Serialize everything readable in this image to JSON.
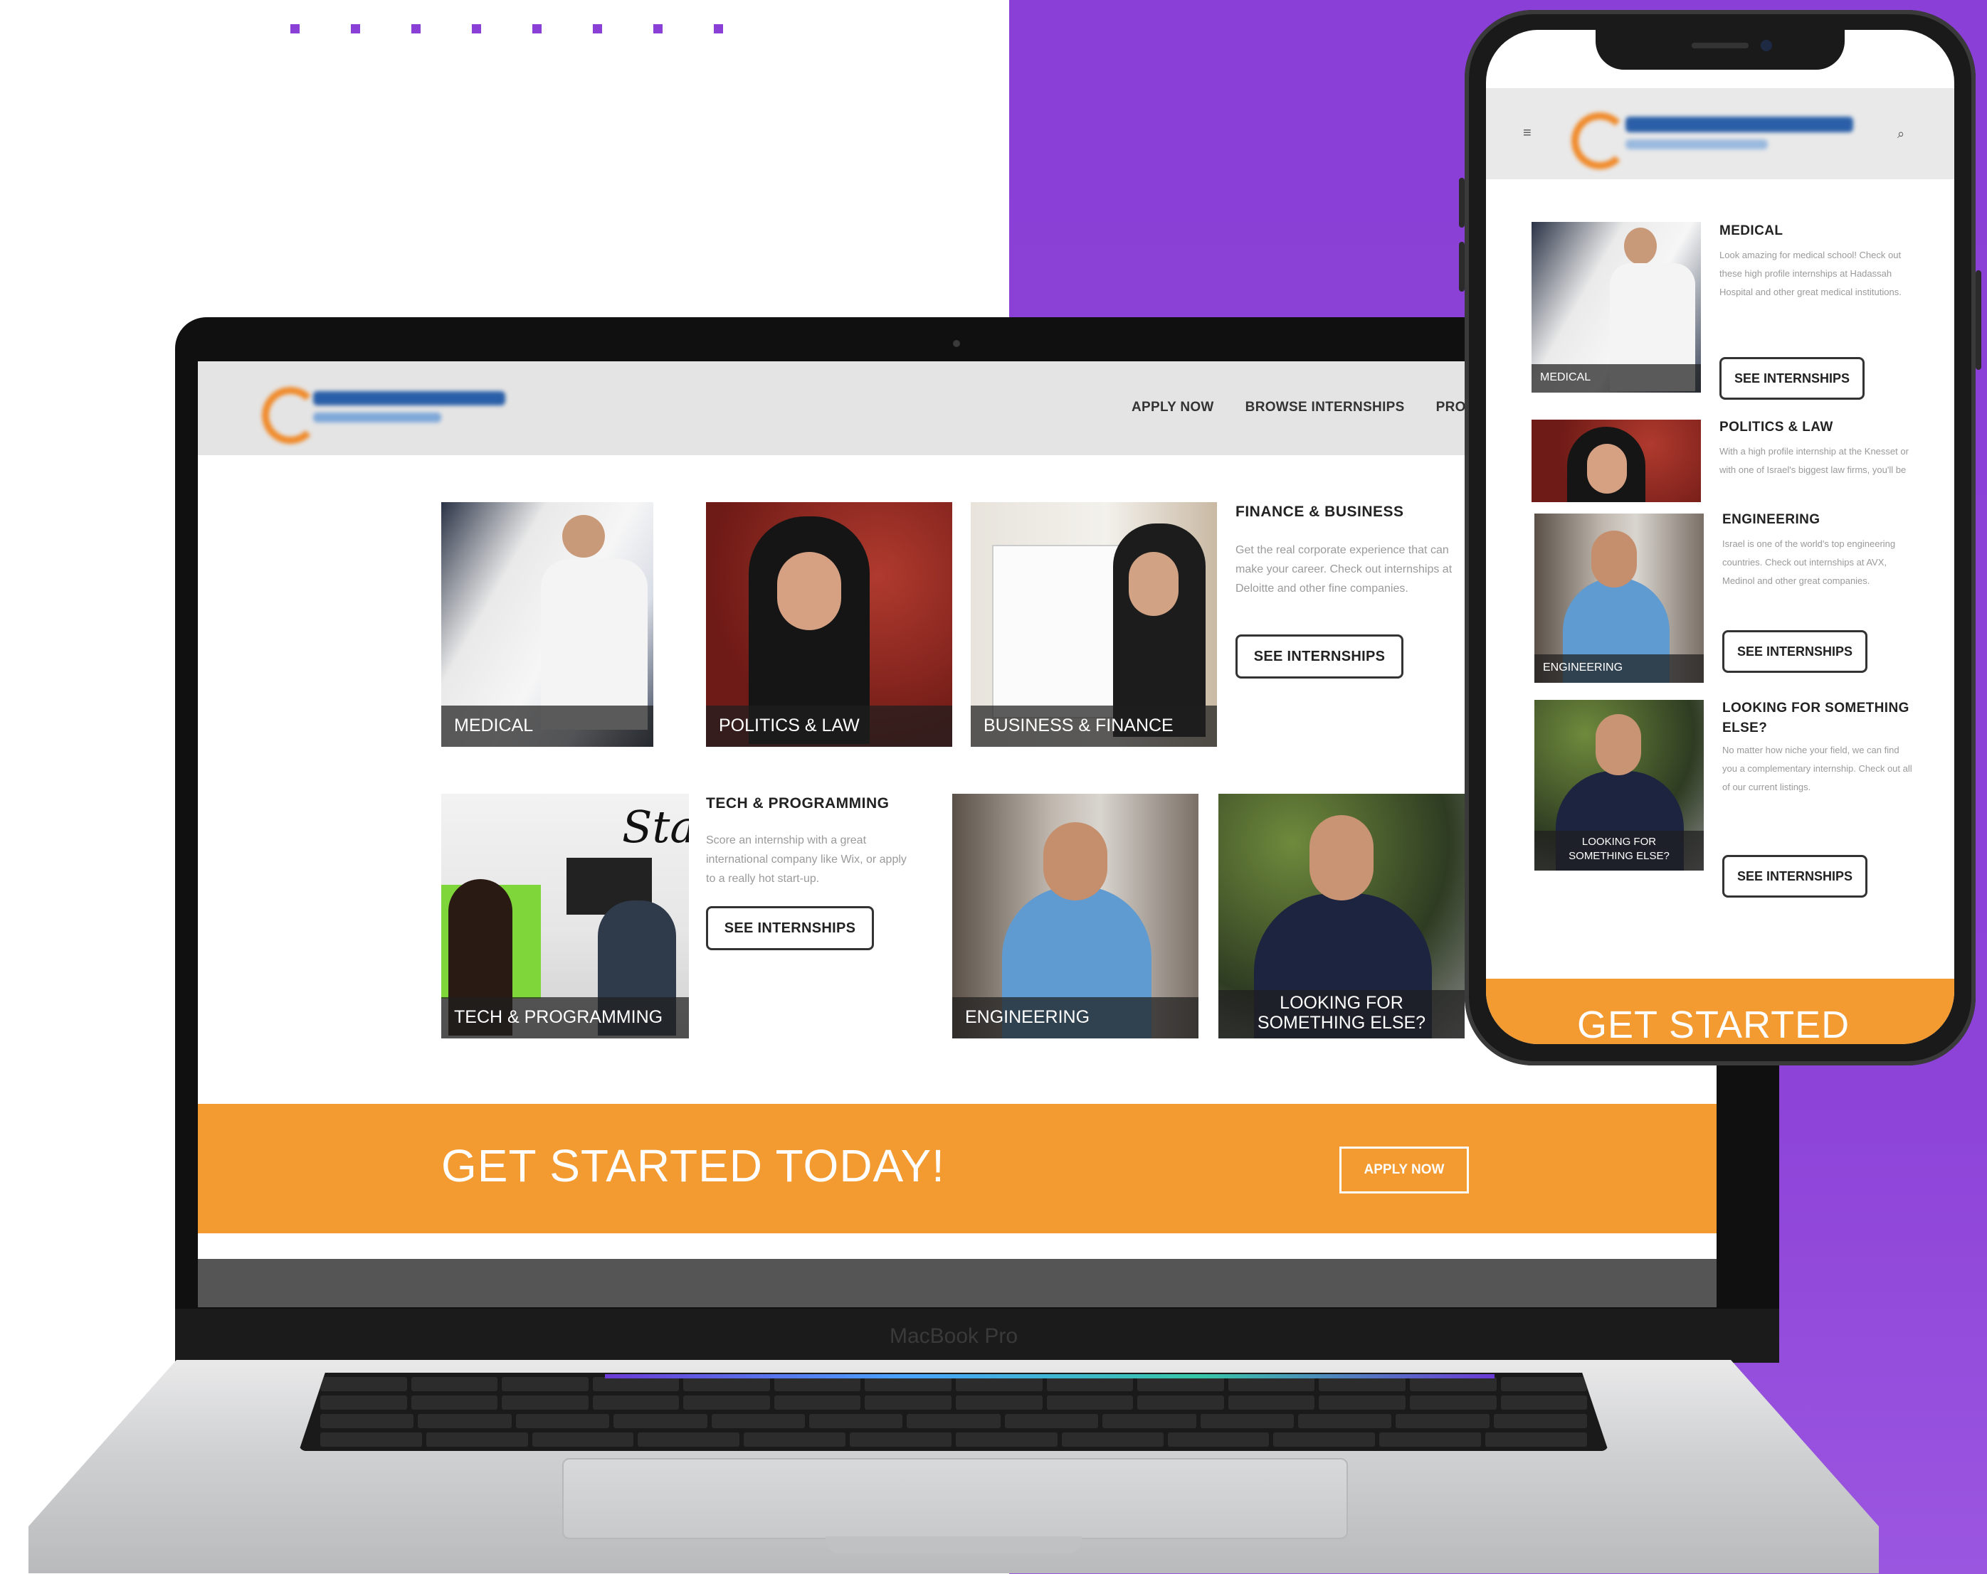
{
  "laptop": {
    "brand_label": "MacBook Pro",
    "nav": [
      "APPLY NOW",
      "BROWSE INTERNSHIPS",
      "PROGRA"
    ],
    "tiles": {
      "medical": "MEDICAL",
      "politics": "POLITICS & LAW",
      "business": "BUSINESS & FINANCE",
      "tech": "TECH & PROGRAMMING",
      "engineering": "ENGINEERING",
      "else_line1": "LOOKING FOR",
      "else_line2": "SOMETHING ELSE?"
    },
    "finance_block": {
      "title": "FINANCE & BUSINESS",
      "text": "Get the real corporate experience that can make your career. Check out internships at Deloitte and other fine companies.",
      "button": "SEE INTERNSHIPS"
    },
    "tech_block": {
      "title": "TECH & PROGRAMMING",
      "text": "Score an internship with a great international company like Wix, or apply to a really hot start-up.",
      "button": "SEE INTERNSHIPS"
    },
    "tech_sign": "Start",
    "cta": {
      "title": "GET STARTED TODAY!",
      "button": "APPLY NOW"
    }
  },
  "phone": {
    "menu_icon": "≡",
    "search_icon": "⌕",
    "medical": {
      "tile": "MEDICAL",
      "title": "MEDICAL",
      "text": "Look amazing for medical school! Check out these high profile internships at Hadassah Hospital and other great medical institutions.",
      "button": "SEE INTERNSHIPS"
    },
    "politics": {
      "title": "POLITICS & LAW",
      "text": "With a high profile internship at the Knesset or with one of Israel's biggest law firms, you'll be"
    },
    "engineering": {
      "tile": "ENGINEERING",
      "title": "ENGINEERING",
      "text": "Israel is one of the world's top engineering countries. Check out internships at AVX, Medinol and other great companies.",
      "button": "SEE INTERNSHIPS"
    },
    "else": {
      "tile_line1": "LOOKING FOR",
      "tile_line2": "SOMETHING ELSE?",
      "title_line1": "LOOKING FOR SOMETHING",
      "title_line2": "ELSE?",
      "text": "No matter how niche your field, we can find you a complementary internship. Check out all of our current listings.",
      "button": "SEE INTERNSHIPS"
    },
    "cta_title": "GET STARTED"
  }
}
